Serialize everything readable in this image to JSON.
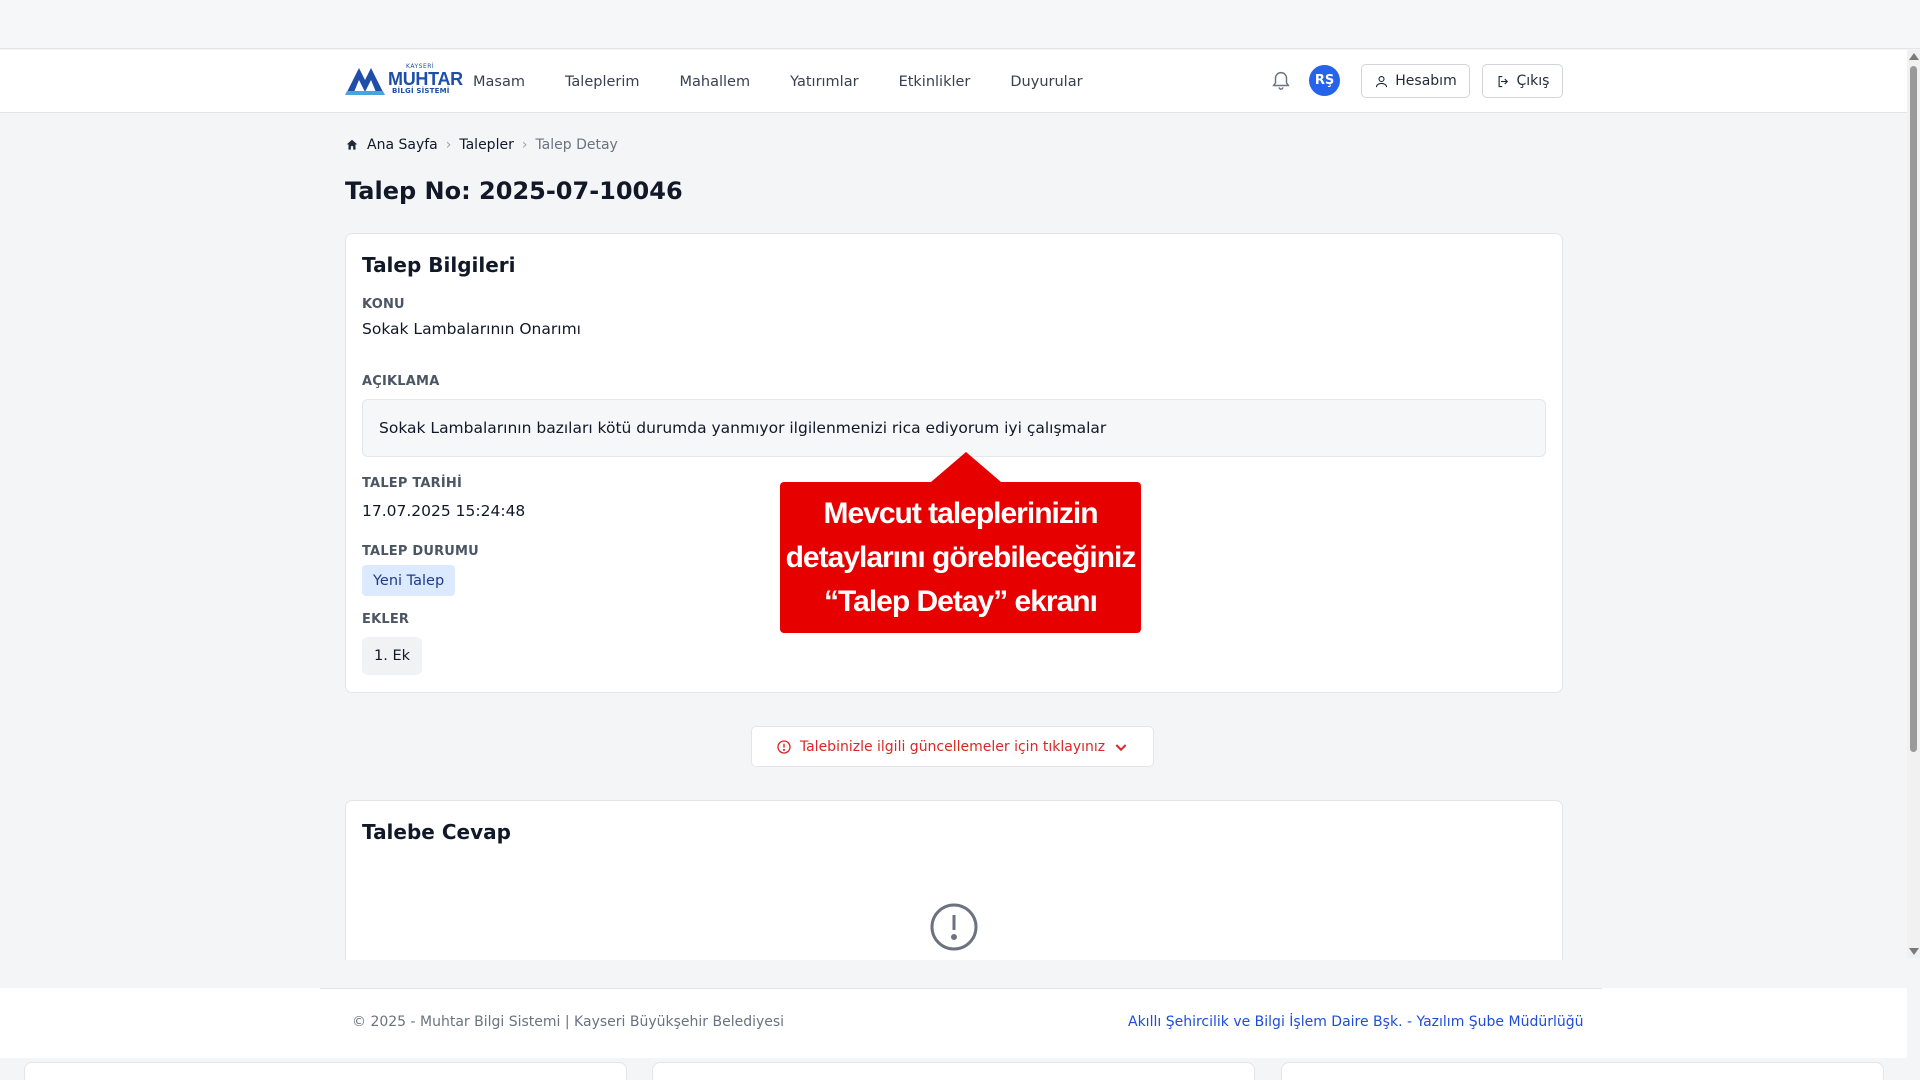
{
  "app": {
    "logo_small": "KAYSERİ",
    "logo_big": "MUHTAR",
    "logo_sub": "BİLGİ SİSTEMİ"
  },
  "nav": {
    "links": [
      "Masam",
      "Taleplerim",
      "Mahallem",
      "Yatırımlar",
      "Etkinlikler",
      "Duyurular"
    ],
    "avatar_initials": "RŞ",
    "account_label": "Hesabım",
    "logout_label": "Çıkış"
  },
  "breadcrumb": [
    "Ana Sayfa",
    "Talepler",
    "Talep Detay"
  ],
  "page": {
    "title": "Talep No: 2025-07-10046"
  },
  "info_card": {
    "title": "Talep Bilgileri",
    "subject_label": "KONU",
    "subject_value": "Sokak Lambalarının Onarımı",
    "description_label": "AÇIKLAMA",
    "description_value": "Sokak Lambalarının bazıları kötü durumda yanmıyor ilgilenmenizi rica ediyorum iyi çalışmalar",
    "date_label": "TALEP TARİHİ",
    "date_value": "17.07.2025 15:24:48",
    "status_label": "TALEP DURUMU",
    "status_value": "Yeni Talep",
    "attachments_label": "EKLER",
    "attachments": [
      "1. Ek"
    ]
  },
  "callout": {
    "lines": [
      "Mevcut taleplerinizin",
      "detaylarını görebileceğiniz",
      "“Talep Detay” ekranı"
    ]
  },
  "updates_button": {
    "label": "Talebinizle ilgili güncellemeler için tıklayınız"
  },
  "answer_card": {
    "title": "Talebe Cevap"
  },
  "footer": {
    "left": "© 2025 - Muhtar Bilgi Sistemi | Kayseri Büyükşehir Belediyesi",
    "right": "Akıllı Şehircilik ve Bilgi İşlem Daire Bşk. - Yazılım Şube Müdürlüğü"
  },
  "colors": {
    "brand_blue": "#1f4ea8",
    "avatar_blue": "#2563eb",
    "callout_red": "#e60000",
    "alert_red": "#dc2626",
    "status_badge_bg": "#dbeafe"
  }
}
